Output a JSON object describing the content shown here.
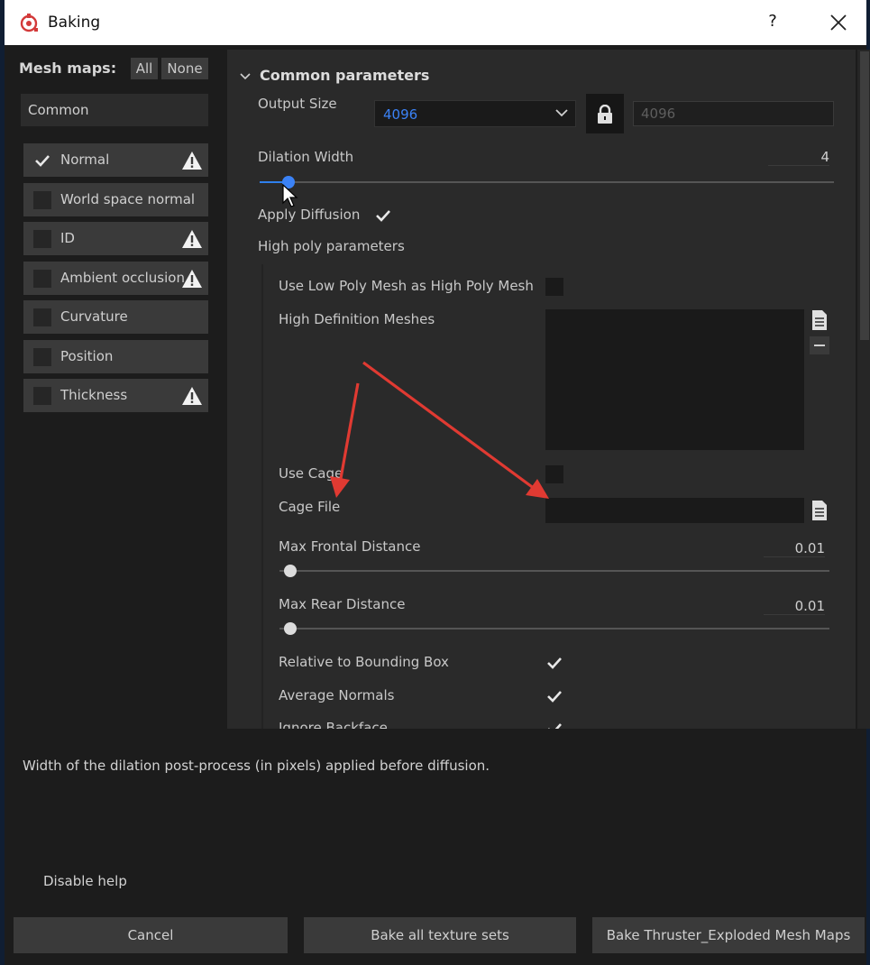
{
  "window": {
    "title": "Baking",
    "help_label": "?",
    "icon": "substance-painter-logo"
  },
  "mesh_maps": {
    "label": "Mesh maps:",
    "all_label": "All",
    "none_label": "None",
    "common_label": "Common",
    "items": [
      {
        "label": "Normal",
        "checked": true,
        "warning": true
      },
      {
        "label": "World space normal",
        "checked": false,
        "warning": false
      },
      {
        "label": "ID",
        "checked": false,
        "warning": true
      },
      {
        "label": "Ambient occlusion",
        "checked": false,
        "warning": true
      },
      {
        "label": "Curvature",
        "checked": false,
        "warning": false
      },
      {
        "label": "Position",
        "checked": false,
        "warning": false
      },
      {
        "label": "Thickness",
        "checked": false,
        "warning": true
      }
    ]
  },
  "common": {
    "section_title": "Common parameters",
    "output_size_label": "Output Size",
    "output_size_value": "4096",
    "output_size_linked_value": "4096",
    "dilation_label": "Dilation Width",
    "dilation_value": "4",
    "dilation_level": 0.05,
    "apply_diffusion_label": "Apply Diffusion",
    "apply_diffusion_checked": true,
    "high_poly_label": "High poly parameters",
    "use_low_poly_label": "Use Low Poly Mesh as High Poly Mesh",
    "use_low_poly_checked": false,
    "high_def_meshes_label": "High Definition Meshes",
    "use_cage_label": "Use Cage",
    "use_cage_checked": false,
    "cage_file_label": "Cage File",
    "max_frontal_label": "Max Frontal Distance",
    "max_frontal_value": "0.01",
    "max_frontal_level": 0.02,
    "max_rear_label": "Max Rear Distance",
    "max_rear_value": "0.01",
    "max_rear_level": 0.02,
    "relative_bbox_label": "Relative to Bounding Box",
    "relative_bbox_checked": true,
    "average_normals_label": "Average Normals",
    "average_normals_checked": true,
    "ignore_backface_label": "Ignore Backface",
    "ignore_backface_checked": true
  },
  "help_text": "Width of the dilation post-process (in pixels) applied before diffusion.",
  "disable_help_label": "Disable help",
  "buttons": {
    "cancel": "Cancel",
    "bake_all": "Bake all texture sets",
    "bake_current": "Bake Thruster_Exploded Mesh Maps"
  },
  "colors": {
    "accent": "#3b82f6",
    "annotation_arrow": "#e03a32",
    "warning": "#ffffff"
  }
}
